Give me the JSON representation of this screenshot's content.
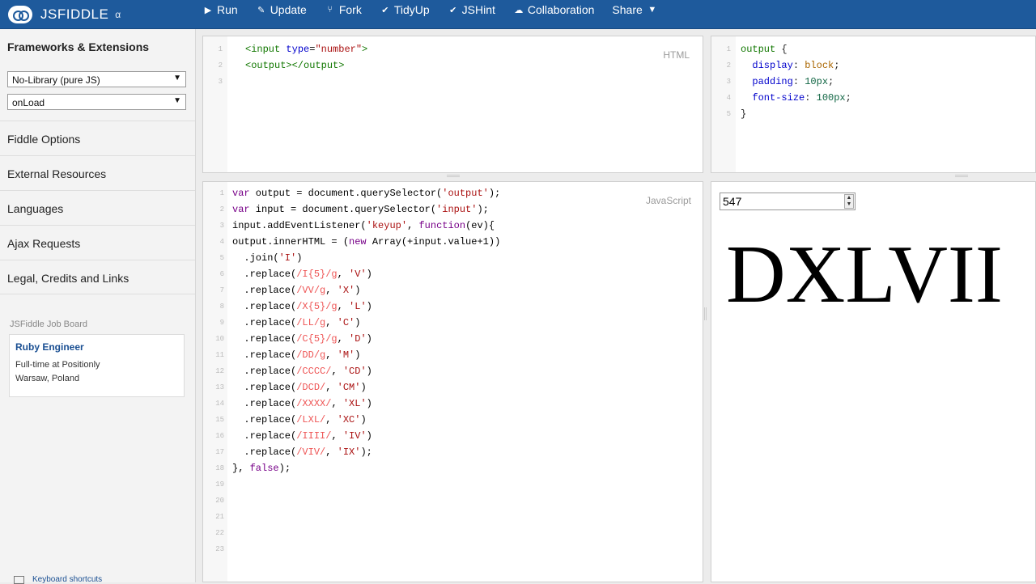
{
  "app": {
    "name": "JSFIDDLE",
    "version_mark": "α"
  },
  "menu": [
    {
      "label": "Run",
      "icon": "play-icon"
    },
    {
      "label": "Update",
      "icon": "pencil-icon"
    },
    {
      "label": "Fork",
      "icon": "fork-icon"
    },
    {
      "label": "TidyUp",
      "icon": "check-icon"
    },
    {
      "label": "JSHint",
      "icon": "check-icon"
    },
    {
      "label": "Collaboration",
      "icon": "cloud-icon"
    },
    {
      "label": "Share",
      "icon": "chevron-down-icon"
    }
  ],
  "sidebar": {
    "heading": "Frameworks & Extensions",
    "library_select": "No-Library (pure JS)",
    "load_select": "onLoad",
    "links": [
      "Fiddle Options",
      "External Resources",
      "Languages",
      "Ajax Requests",
      "Legal, Credits and Links"
    ],
    "job_board": {
      "title": "JSFiddle Job Board",
      "role": "Ruby Engineer",
      "company": "Full-time at Positionly",
      "location": "Warsaw, Poland"
    },
    "keyboard_shortcuts": "Keyboard shortcuts"
  },
  "html_panel": {
    "label": "HTML",
    "line_numbers": [
      "1",
      "2",
      "3"
    ],
    "code": [
      "<input type=\"number\">",
      "<output></output>",
      ""
    ]
  },
  "css_panel": {
    "line_numbers": [
      "1",
      "2",
      "3",
      "4",
      "5"
    ],
    "code": [
      "output {",
      "  display: block;",
      "  padding: 10px;",
      "  font-size: 100px;",
      "}"
    ]
  },
  "js_panel": {
    "label": "JavaScript",
    "line_numbers": [
      "1",
      "2",
      "3",
      "4",
      "5",
      "6",
      "7",
      "8",
      "9",
      "10",
      "11",
      "12",
      "13",
      "14",
      "15",
      "16",
      "17",
      "18",
      "19",
      "20",
      "21",
      "22",
      "23"
    ],
    "code": [
      "var output = document.querySelector('output');",
      "var input = document.querySelector('input');",
      "input.addEventListener('keyup', function(ev){",
      "output.innerHTML = (new Array(+input.value+1))",
      "  .join('I')",
      "  .replace(/I{5}/g, 'V')",
      "  .replace(/VV/g, 'X')",
      "  .replace(/X{5}/g, 'L')",
      "  .replace(/LL/g, 'C')",
      "  .replace(/C{5}/g, 'D')",
      "  .replace(/DD/g, 'M')",
      "  .replace(/CCCC/, 'CD')",
      "  .replace(/DCD/, 'CM')",
      "  .replace(/XXXX/, 'XL')",
      "  .replace(/LXL/, 'XC')",
      "  .replace(/IIII/, 'IV')",
      "  .replace(/VIV/, 'IX');",
      "}, false);",
      "",
      "",
      "",
      "",
      ""
    ]
  },
  "result": {
    "input_value": "547",
    "output_text": "DXLVII"
  }
}
